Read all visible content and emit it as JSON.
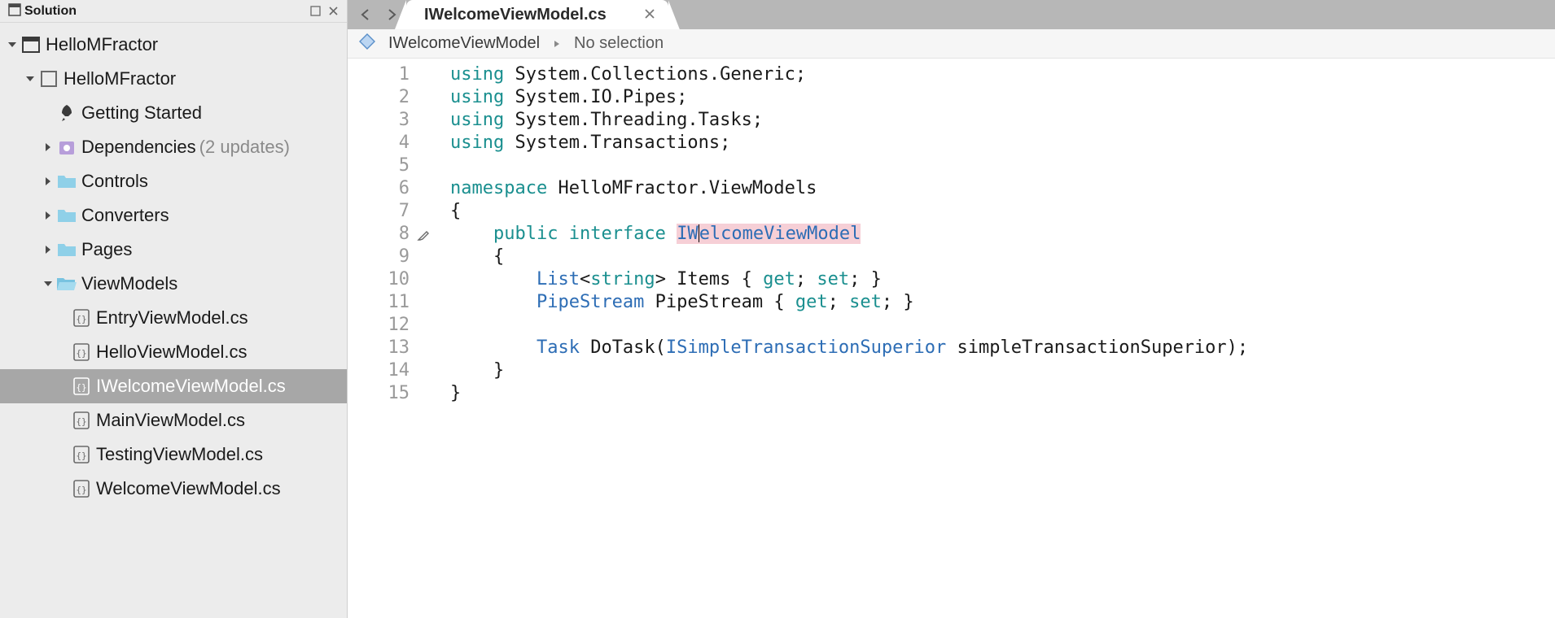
{
  "sidebar": {
    "title": "Solution",
    "tree": {
      "solution": {
        "label": "HelloMFractor"
      },
      "project": {
        "label": "HelloMFractor"
      },
      "getting_started": {
        "label": "Getting Started"
      },
      "dependencies": {
        "label": "Dependencies",
        "note": "(2 updates)"
      },
      "controls": {
        "label": "Controls"
      },
      "converters": {
        "label": "Converters"
      },
      "pages": {
        "label": "Pages"
      },
      "viewmodels": {
        "label": "ViewModels"
      },
      "files": [
        {
          "label": "EntryViewModel.cs"
        },
        {
          "label": "HelloViewModel.cs"
        },
        {
          "label": "IWelcomeViewModel.cs",
          "selected": true
        },
        {
          "label": "MainViewModel.cs"
        },
        {
          "label": "TestingViewModel.cs"
        },
        {
          "label": "WelcomeViewModel.cs"
        }
      ]
    }
  },
  "editor": {
    "tab": {
      "label": "IWelcomeViewModel.cs"
    },
    "breadcrumb": {
      "item": "IWelcomeViewModel",
      "secondary": "No selection"
    },
    "code": {
      "lines": [
        {
          "n": "1",
          "tokens": [
            [
              "kw",
              "using"
            ],
            [
              "text",
              " System.Collections.Generic;"
            ]
          ]
        },
        {
          "n": "2",
          "tokens": [
            [
              "kw",
              "using"
            ],
            [
              "text",
              " System.IO.Pipes;"
            ]
          ]
        },
        {
          "n": "3",
          "tokens": [
            [
              "kw",
              "using"
            ],
            [
              "text",
              " System.Threading.Tasks;"
            ]
          ]
        },
        {
          "n": "4",
          "tokens": [
            [
              "kw",
              "using"
            ],
            [
              "text",
              " System.Transactions;"
            ]
          ]
        },
        {
          "n": "5",
          "tokens": []
        },
        {
          "n": "6",
          "tokens": [
            [
              "ns",
              "namespace"
            ],
            [
              "text",
              " HelloMFractor.ViewModels"
            ]
          ]
        },
        {
          "n": "7",
          "tokens": [
            [
              "text",
              "{"
            ]
          ]
        },
        {
          "n": "8",
          "marker": "brush",
          "indent": 1,
          "tokens": [
            [
              "kw",
              "public"
            ],
            [
              "text",
              " "
            ],
            [
              "kw",
              "interface"
            ],
            [
              "text",
              " "
            ],
            [
              "hl_type",
              "IWelcomeViewModel"
            ]
          ]
        },
        {
          "n": "9",
          "indent": 1,
          "tokens": [
            [
              "text",
              "{"
            ]
          ]
        },
        {
          "n": "10",
          "indent": 2,
          "tokens": [
            [
              "type",
              "List"
            ],
            [
              "text",
              "<"
            ],
            [
              "kw",
              "string"
            ],
            [
              "text",
              "> Items { "
            ],
            [
              "kw",
              "get"
            ],
            [
              "text",
              "; "
            ],
            [
              "kw",
              "set"
            ],
            [
              "text",
              "; }"
            ]
          ]
        },
        {
          "n": "11",
          "indent": 2,
          "tokens": [
            [
              "type",
              "PipeStream"
            ],
            [
              "text",
              " PipeStream { "
            ],
            [
              "kw",
              "get"
            ],
            [
              "text",
              "; "
            ],
            [
              "kw",
              "set"
            ],
            [
              "text",
              "; }"
            ]
          ]
        },
        {
          "n": "12",
          "indent": 2,
          "tokens": []
        },
        {
          "n": "13",
          "indent": 2,
          "tokens": [
            [
              "type",
              "Task"
            ],
            [
              "text",
              " DoTask("
            ],
            [
              "type",
              "ISimpleTransactionSuperior"
            ],
            [
              "text",
              " simpleTransactionSuperior);"
            ]
          ]
        },
        {
          "n": "14",
          "indent": 1,
          "tokens": [
            [
              "text",
              "}"
            ]
          ]
        },
        {
          "n": "15",
          "tokens": [
            [
              "text",
              "}"
            ]
          ]
        }
      ]
    }
  }
}
